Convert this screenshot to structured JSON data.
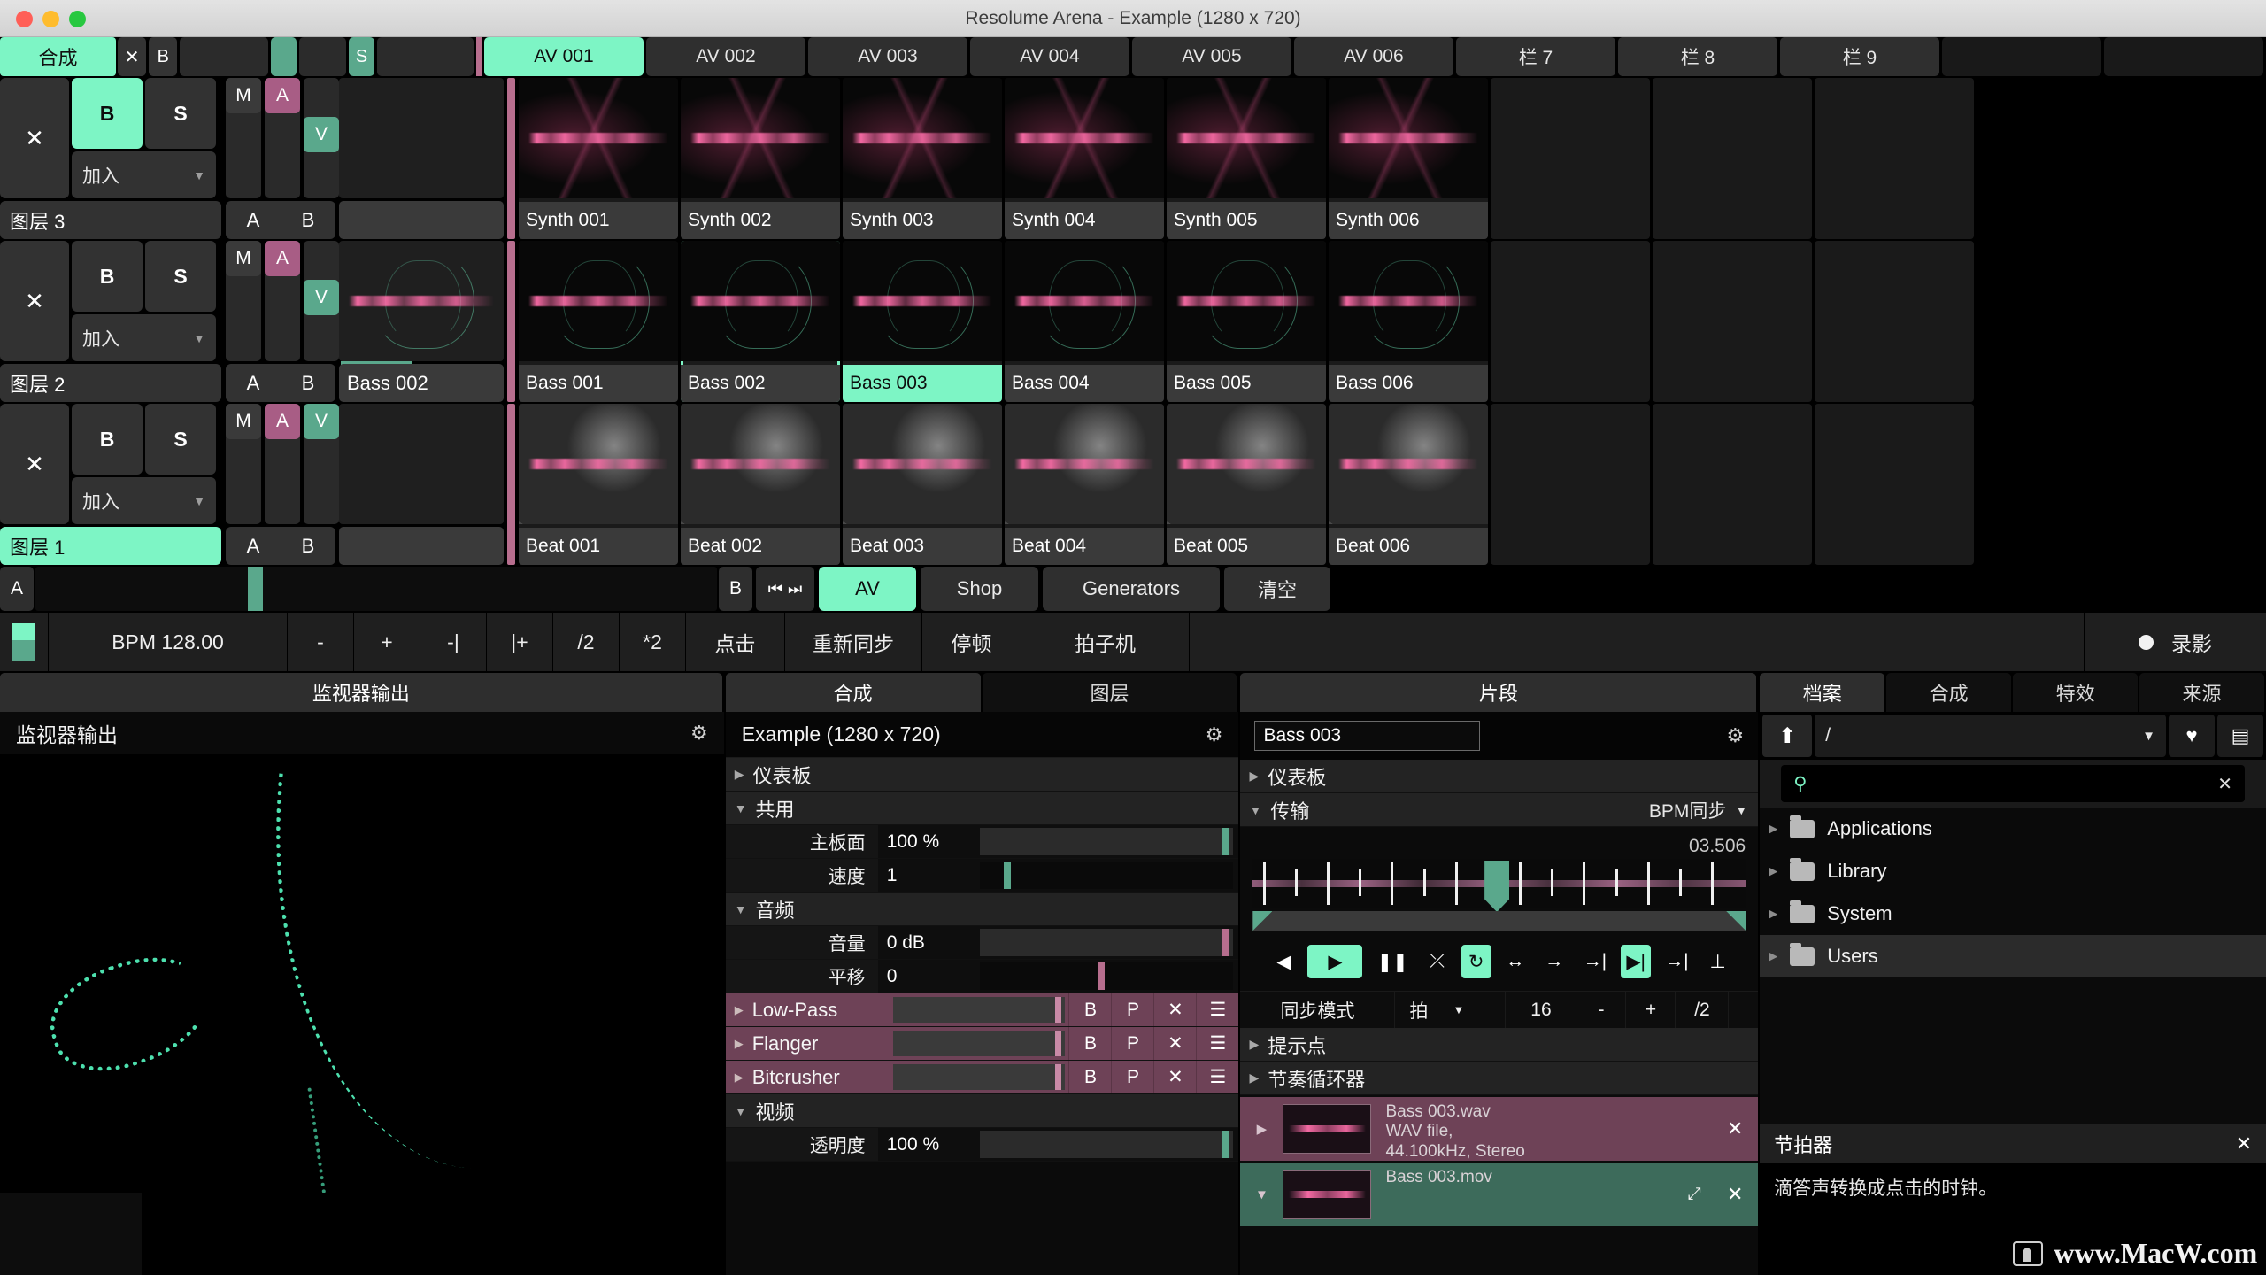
{
  "window": {
    "title": "Resolume Arena - Example (1280 x 720)"
  },
  "deck_header": {
    "composition_tab": "合成",
    "close_label": "✕",
    "bypass_label": "B",
    "solo_label": "S",
    "columns": [
      {
        "label": "AV 001",
        "active": true
      },
      {
        "label": "AV 002",
        "active": false
      },
      {
        "label": "AV 003",
        "active": false
      },
      {
        "label": "AV 004",
        "active": false
      },
      {
        "label": "AV 005",
        "active": false
      },
      {
        "label": "AV 006",
        "active": false
      },
      {
        "label": "栏 7",
        "active": false
      },
      {
        "label": "栏 8",
        "active": false
      },
      {
        "label": "栏 9",
        "active": false
      }
    ]
  },
  "layers": [
    {
      "name": "图层 3",
      "name_active": false,
      "bypass_label": "B",
      "bypass_on": true,
      "solo_label": "S",
      "close_label": "✕",
      "blend_mode": "加入",
      "mute_label": "M",
      "audio_label": "A",
      "video_label": "V",
      "a_label": "A",
      "b_label": "B",
      "preview_label": "",
      "clips": [
        {
          "label": "Synth 001",
          "state": "normal",
          "art": "magenta"
        },
        {
          "label": "Synth 002",
          "state": "normal",
          "art": "magenta"
        },
        {
          "label": "Synth 003",
          "state": "normal",
          "art": "magenta"
        },
        {
          "label": "Synth 004",
          "state": "normal",
          "art": "magenta"
        },
        {
          "label": "Synth 005",
          "state": "normal",
          "art": "magenta"
        },
        {
          "label": "Synth 006",
          "state": "normal",
          "art": "magenta"
        },
        {
          "label": "",
          "state": "empty",
          "art": "none"
        },
        {
          "label": "",
          "state": "empty",
          "art": "none"
        },
        {
          "label": "",
          "state": "empty",
          "art": "none"
        }
      ]
    },
    {
      "name": "图层 2",
      "name_active": false,
      "bypass_label": "B",
      "bypass_on": false,
      "solo_label": "S",
      "close_label": "✕",
      "blend_mode": "加入",
      "mute_label": "M",
      "audio_label": "A",
      "video_label": "V",
      "a_label": "A",
      "b_label": "B",
      "preview_label": "Bass 002",
      "clips": [
        {
          "label": "Bass 001",
          "state": "normal",
          "art": "vector"
        },
        {
          "label": "Bass 002",
          "state": "selected",
          "art": "vector"
        },
        {
          "label": "Bass 003",
          "state": "playing",
          "art": "vector"
        },
        {
          "label": "Bass 004",
          "state": "normal",
          "art": "vector"
        },
        {
          "label": "Bass 005",
          "state": "normal",
          "art": "vector"
        },
        {
          "label": "Bass 006",
          "state": "normal",
          "art": "vector"
        },
        {
          "label": "",
          "state": "empty",
          "art": "none"
        },
        {
          "label": "",
          "state": "empty",
          "art": "none"
        },
        {
          "label": "",
          "state": "empty",
          "art": "none"
        }
      ]
    },
    {
      "name": "图层 1",
      "name_active": true,
      "bypass_label": "B",
      "bypass_on": false,
      "solo_label": "S",
      "close_label": "✕",
      "blend_mode": "加入",
      "mute_label": "M",
      "audio_label": "A",
      "video_label": "V",
      "a_label": "A",
      "b_label": "B",
      "preview_label": "",
      "clips": [
        {
          "label": "Beat 001",
          "state": "normal",
          "art": "city"
        },
        {
          "label": "Beat 002",
          "state": "normal",
          "art": "city"
        },
        {
          "label": "Beat 003",
          "state": "normal",
          "art": "city"
        },
        {
          "label": "Beat 004",
          "state": "normal",
          "art": "city"
        },
        {
          "label": "Beat 005",
          "state": "normal",
          "art": "city"
        },
        {
          "label": "Beat 006",
          "state": "normal",
          "art": "city"
        },
        {
          "label": "",
          "state": "empty",
          "art": "none"
        },
        {
          "label": "",
          "state": "empty",
          "art": "none"
        },
        {
          "label": "",
          "state": "empty",
          "art": "none"
        }
      ]
    }
  ],
  "deckbar": {
    "crossfade_a": "A",
    "crossfade_b": "B",
    "skip_prev": "⏮",
    "skip_next": "⏭",
    "tabs": [
      {
        "label": "AV",
        "active": true
      },
      {
        "label": "Shop",
        "active": false
      },
      {
        "label": "Generators",
        "active": false
      },
      {
        "label": "清空",
        "active": false
      }
    ]
  },
  "bpmbar": {
    "bpm_label": "BPM  128.00",
    "minus": "-",
    "plus": "+",
    "nudge_down": "-|",
    "nudge_up": "|+",
    "half": "/2",
    "double": "*2",
    "tap": "点击",
    "resync": "重新同步",
    "pause": "停顿",
    "metronome": "拍子机",
    "record": "录影"
  },
  "monitor": {
    "tab": "监视器输出",
    "header": "监视器输出",
    "gear": "⚙"
  },
  "composition": {
    "tabs": [
      {
        "label": "合成",
        "active": true
      },
      {
        "label": "图层",
        "active": false
      }
    ],
    "title": "Example (1280 x 720)",
    "gear": "⚙",
    "groups": {
      "dashboard": "仪表板",
      "common": "共用",
      "audio": "音频",
      "video": "视频"
    },
    "params": [
      {
        "label": "主板面",
        "value": "100 %",
        "knob_pct": 97,
        "color": "green"
      },
      {
        "label": "速度",
        "value": "1",
        "knob_pct": 11,
        "color": "green"
      }
    ],
    "audio_params": [
      {
        "label": "音量",
        "value": "0 dB",
        "knob_pct": 97,
        "color": "pink"
      },
      {
        "label": "平移",
        "value": "0",
        "knob_pct": 48,
        "color": "pink"
      }
    ],
    "video_params": [
      {
        "label": "透明度",
        "value": "100 %",
        "knob_pct": 97,
        "color": "green"
      }
    ],
    "effects": [
      {
        "name": "Low-Pass",
        "b": "B",
        "p": "P",
        "x": "✕",
        "menu": "☰"
      },
      {
        "name": "Flanger",
        "b": "B",
        "p": "P",
        "x": "✕",
        "menu": "☰"
      },
      {
        "name": "Bitcrusher",
        "b": "B",
        "p": "P",
        "x": "✕",
        "menu": "☰"
      }
    ]
  },
  "clip_panel": {
    "tab": "片段",
    "clip_name": "Bass 003",
    "gear": "⚙",
    "dashboard": "仪表板",
    "transport": "传输",
    "transport_mode": "BPM同步",
    "time": "03.506",
    "buttons": {
      "reverse": "◀",
      "play": "▶",
      "pause": "❚❚",
      "random": "⤫",
      "loop": "↻",
      "bounce": "↔",
      "forward_once": "→",
      "play_to_end": "→|",
      "cue_in": "▶|",
      "cue_mid": "→|",
      "cue_out": "⊥"
    },
    "sync_mode_label": "同步模式",
    "sync_unit": "拍",
    "sync_beats": "16",
    "sync_minus": "-",
    "sync_plus": "+",
    "sync_half": "/2",
    "cue_points": "提示点",
    "beat_loop": "节奏循环器",
    "files": [
      {
        "name": "Bass 003.wav",
        "line2": "WAV file,",
        "line3": "44.100kHz, Stereo",
        "color": "purple",
        "close": "✕"
      },
      {
        "name": "Bass 003.mov",
        "line2": "",
        "line3": "",
        "color": "green",
        "close": "✕",
        "expand": "⤢"
      }
    ]
  },
  "browser": {
    "tabs": [
      {
        "label": "档案",
        "active": true
      },
      {
        "label": "合成",
        "active": false
      },
      {
        "label": "特效",
        "active": false
      },
      {
        "label": "来源",
        "active": false
      }
    ],
    "up_icon": "⬆",
    "path": "/",
    "favorite_icon": "♥",
    "viewmode_icon": "▤",
    "search_placeholder": "",
    "search_clear": "✕",
    "items": [
      {
        "label": "Applications",
        "selected": false
      },
      {
        "label": "Library",
        "selected": false
      },
      {
        "label": "System",
        "selected": false
      },
      {
        "label": "Users",
        "selected": true
      }
    ]
  },
  "metronome": {
    "title": "节拍器",
    "close": "✕",
    "description": "滴答声转换成点击的时钟。",
    "watermark": "www.MacW.com"
  }
}
